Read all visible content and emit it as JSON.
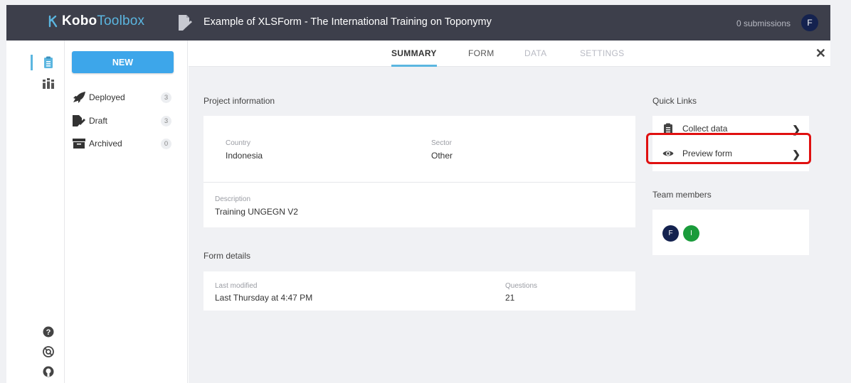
{
  "header": {
    "logo_bold": "Kobo",
    "logo_thin": "Toolbox",
    "project_title": "Example of XLSForm - The International Training on Toponymy",
    "submissions": "0 submissions",
    "user_initial": "F"
  },
  "leftnav": {
    "icons": [
      "clipboard-icon",
      "library-icon",
      "help-icon",
      "support-icon",
      "github-icon"
    ]
  },
  "sidebar": {
    "new_label": "NEW",
    "items": [
      {
        "label": "Deployed",
        "count": "3",
        "icon": "rocket-icon"
      },
      {
        "label": "Draft",
        "count": "3",
        "icon": "draft-icon"
      },
      {
        "label": "Archived",
        "count": "0",
        "icon": "archive-icon"
      }
    ]
  },
  "tabs": [
    {
      "label": "SUMMARY",
      "state": "active"
    },
    {
      "label": "FORM",
      "state": "enabled"
    },
    {
      "label": "DATA",
      "state": "disabled"
    },
    {
      "label": "SETTINGS",
      "state": "disabled"
    }
  ],
  "project_info": {
    "heading": "Project information",
    "country_label": "Country",
    "country_value": "Indonesia",
    "sector_label": "Sector",
    "sector_value": "Other",
    "description_label": "Description",
    "description_value": "Training UNGEGN V2"
  },
  "form_details": {
    "heading": "Form details",
    "last_modified_label": "Last modified",
    "last_modified_value": "Last Thursday at 4:47 PM",
    "questions_label": "Questions",
    "questions_value": "21"
  },
  "quick_links": {
    "heading": "Quick Links",
    "items": [
      {
        "label": "Collect data",
        "icon": "clipboard-icon"
      },
      {
        "label": "Preview form",
        "icon": "eye-icon"
      }
    ]
  },
  "team": {
    "heading": "Team members",
    "members": [
      {
        "initial": "F",
        "color": "#14224f"
      },
      {
        "initial": "I",
        "color": "#1a9b3b"
      }
    ]
  },
  "colors": {
    "topbar": "#3d3f4b",
    "accent": "#3da6ea",
    "highlight": "#e01010"
  }
}
